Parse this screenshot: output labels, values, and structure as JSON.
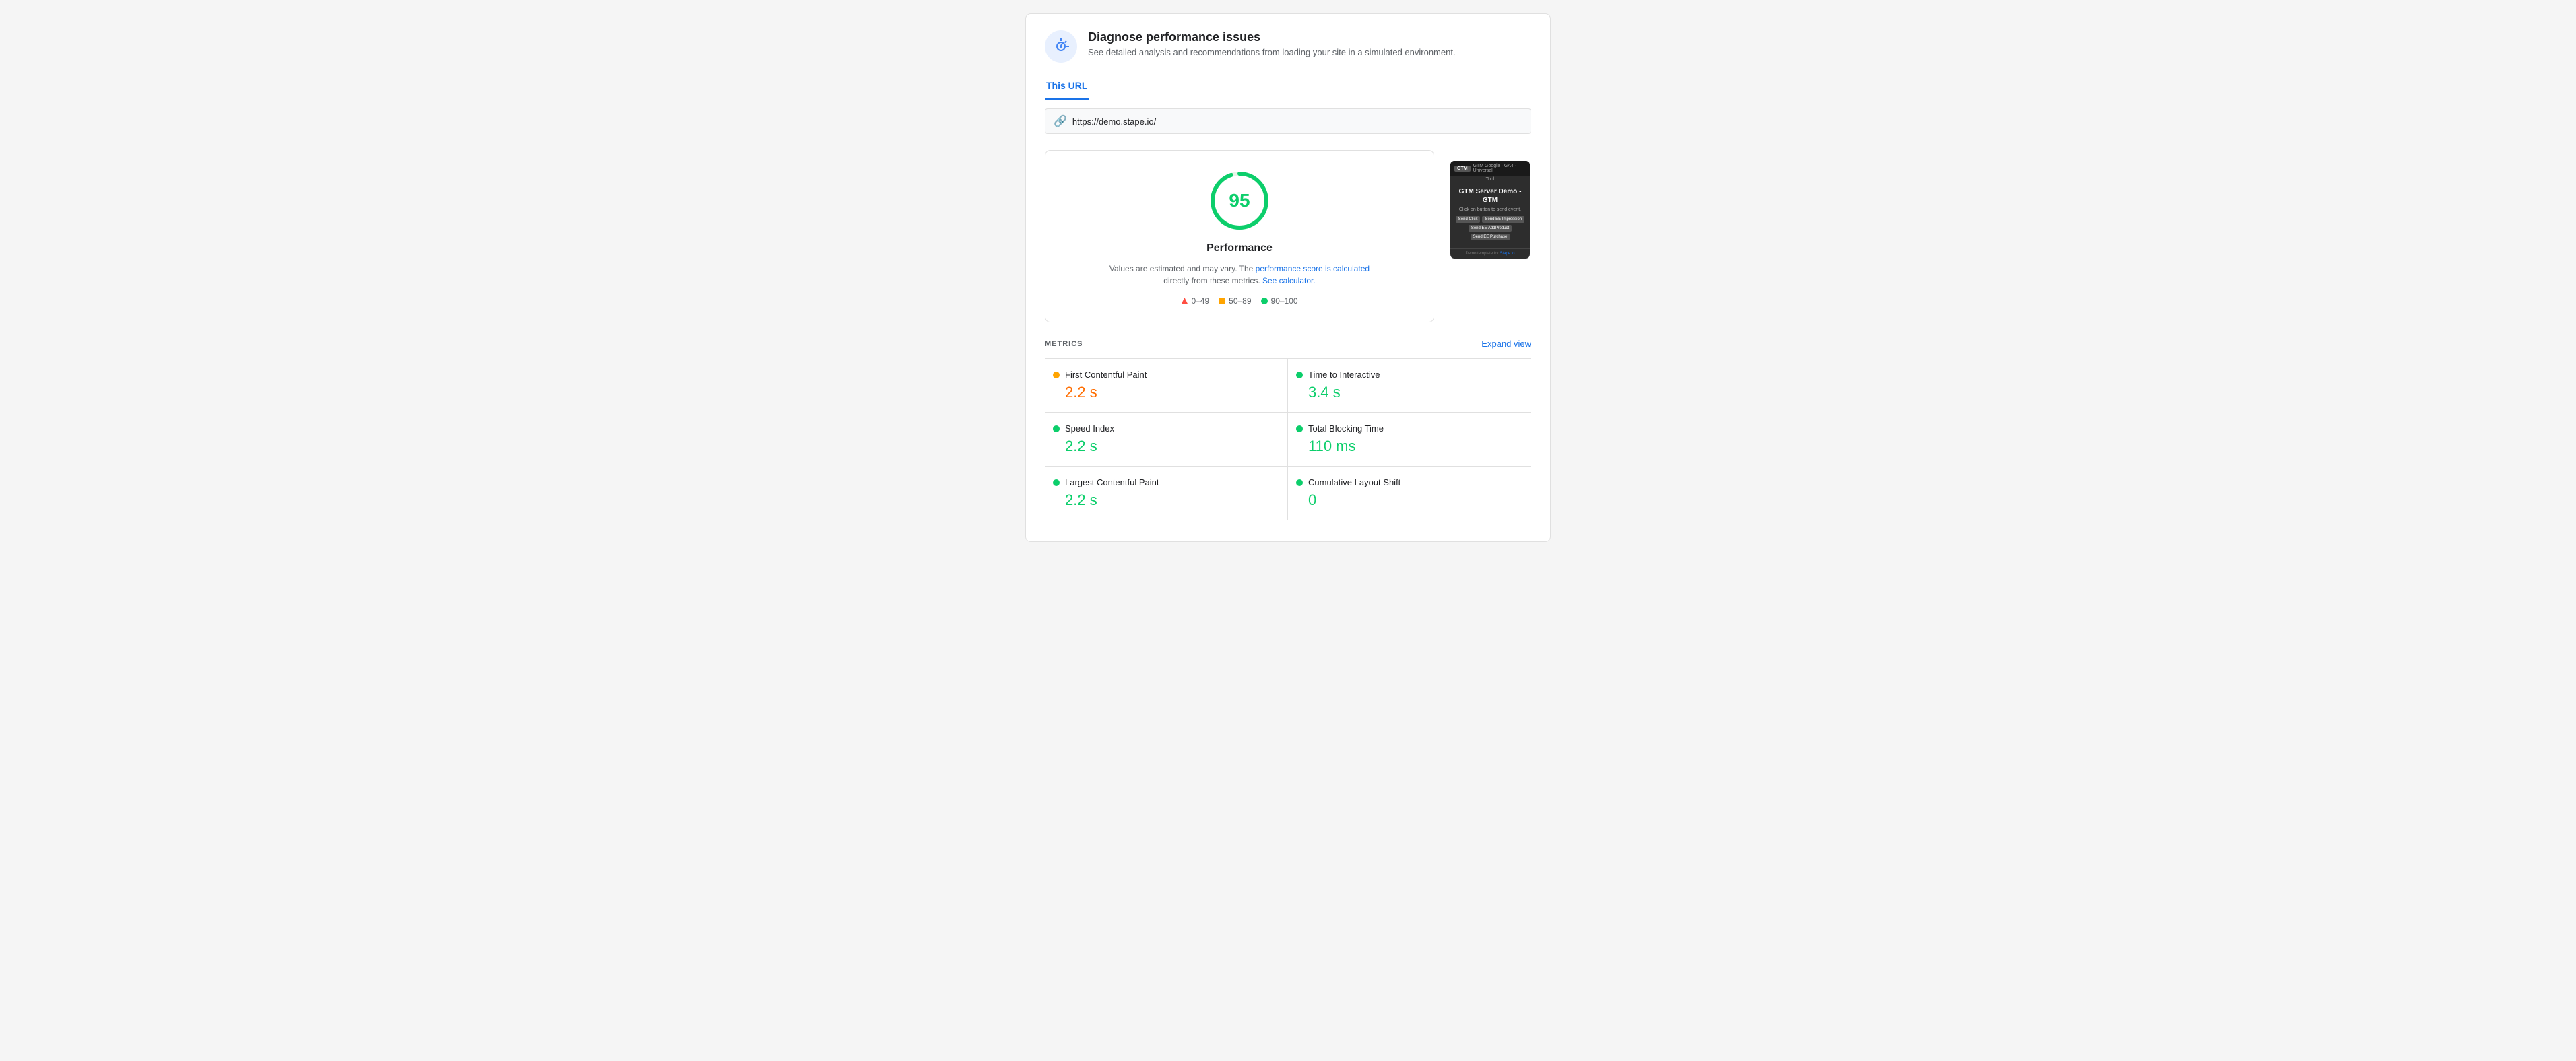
{
  "header": {
    "title": "Diagnose performance issues",
    "description": "See detailed analysis and recommendations from loading your site in a simulated environment."
  },
  "tabs": [
    {
      "label": "This URL",
      "active": true
    }
  ],
  "url_bar": {
    "url": "https://demo.stape.io/"
  },
  "score": {
    "value": "95",
    "label": "Performance",
    "note_text": "Values are estimated and may vary. The",
    "note_link1": "performance score is calculated",
    "note_link2": "See calculator.",
    "note_middle": "directly from these metrics."
  },
  "legend": [
    {
      "range": "0–49",
      "color": "red"
    },
    {
      "range": "50–89",
      "color": "orange"
    },
    {
      "range": "90–100",
      "color": "green"
    }
  ],
  "preview": {
    "top_tag": "GTM",
    "top_tags": [
      "GTM",
      "GTM Google",
      "GA4",
      "Universal",
      "Tool"
    ],
    "title": "GTM Server Demo - GTM",
    "description": "Click on button to send event.",
    "buttons": [
      "Send Click",
      "Send EE Impression",
      "Send EE AddProduct",
      "Send EE Purchase"
    ],
    "footer": "Demo template for Stape.io"
  },
  "metrics": {
    "section_title": "METRICS",
    "expand_label": "Expand view",
    "items": [
      {
        "name": "First Contentful Paint",
        "value": "2.2 s",
        "color": "orange",
        "dot": "orange"
      },
      {
        "name": "Time to Interactive",
        "value": "3.4 s",
        "color": "green",
        "dot": "green"
      },
      {
        "name": "Speed Index",
        "value": "2.2 s",
        "color": "green",
        "dot": "green"
      },
      {
        "name": "Total Blocking Time",
        "value": "110 ms",
        "color": "green",
        "dot": "green"
      },
      {
        "name": "Largest Contentful Paint",
        "value": "2.2 s",
        "color": "green",
        "dot": "green"
      },
      {
        "name": "Cumulative Layout Shift",
        "value": "0",
        "color": "green",
        "dot": "green"
      }
    ]
  }
}
